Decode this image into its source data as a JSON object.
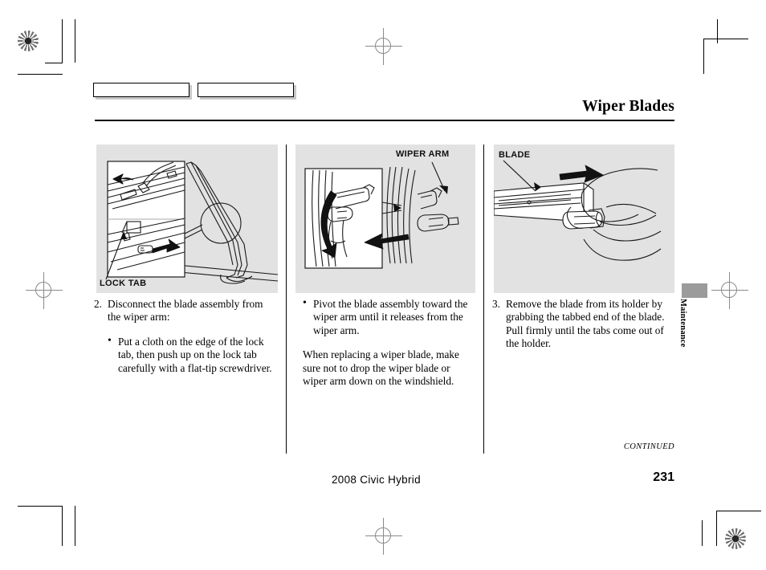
{
  "document": {
    "title": "Wiper Blades",
    "page_number": "231",
    "model_footer": "2008  Civic  Hybrid",
    "continued_label": "CONTINUED",
    "section_tab": "Maintenance"
  },
  "index_tabs": [
    {
      "name": "index-tab-1",
      "label": ""
    },
    {
      "name": "index-tab-2",
      "label": ""
    }
  ],
  "panels": [
    {
      "id": "panel-lock-tab",
      "label": "LOCK TAB",
      "illustration": "wiper-blade-lock-tab-diagram"
    },
    {
      "id": "panel-wiper-arm",
      "label": "WIPER ARM",
      "illustration": "wiper-arm-pivot-diagram"
    },
    {
      "id": "panel-blade",
      "label": "BLADE",
      "illustration": "blade-removal-hand-diagram"
    }
  ],
  "columns": [
    {
      "id": "column-1",
      "blocks": [
        {
          "type": "numbered",
          "number": "2.",
          "text": "Disconnect the blade assembly from the wiper arm:"
        },
        {
          "type": "bullet",
          "text": "Put a cloth on the edge of the lock tab, then push up on the lock tab carefully with a flat-tip screwdriver."
        }
      ]
    },
    {
      "id": "column-2",
      "blocks": [
        {
          "type": "bullet",
          "text": "Pivot the blade assembly toward the wiper arm until it releases from the wiper arm."
        },
        {
          "type": "paragraph",
          "text": "When replacing a wiper blade, make sure not to drop the wiper blade or wiper arm down on the windshield."
        }
      ]
    },
    {
      "id": "column-3",
      "blocks": [
        {
          "type": "numbered",
          "number": "3.",
          "text": "Remove the blade from its holder by grabbing the tabbed end of the blade. Pull firmly until the tabs come out of the holder."
        }
      ]
    }
  ],
  "colors": {
    "panel_background": "#e2e2e2",
    "tab_gray": "#9b9b9b",
    "rule": "#000000",
    "text": "#000000"
  }
}
